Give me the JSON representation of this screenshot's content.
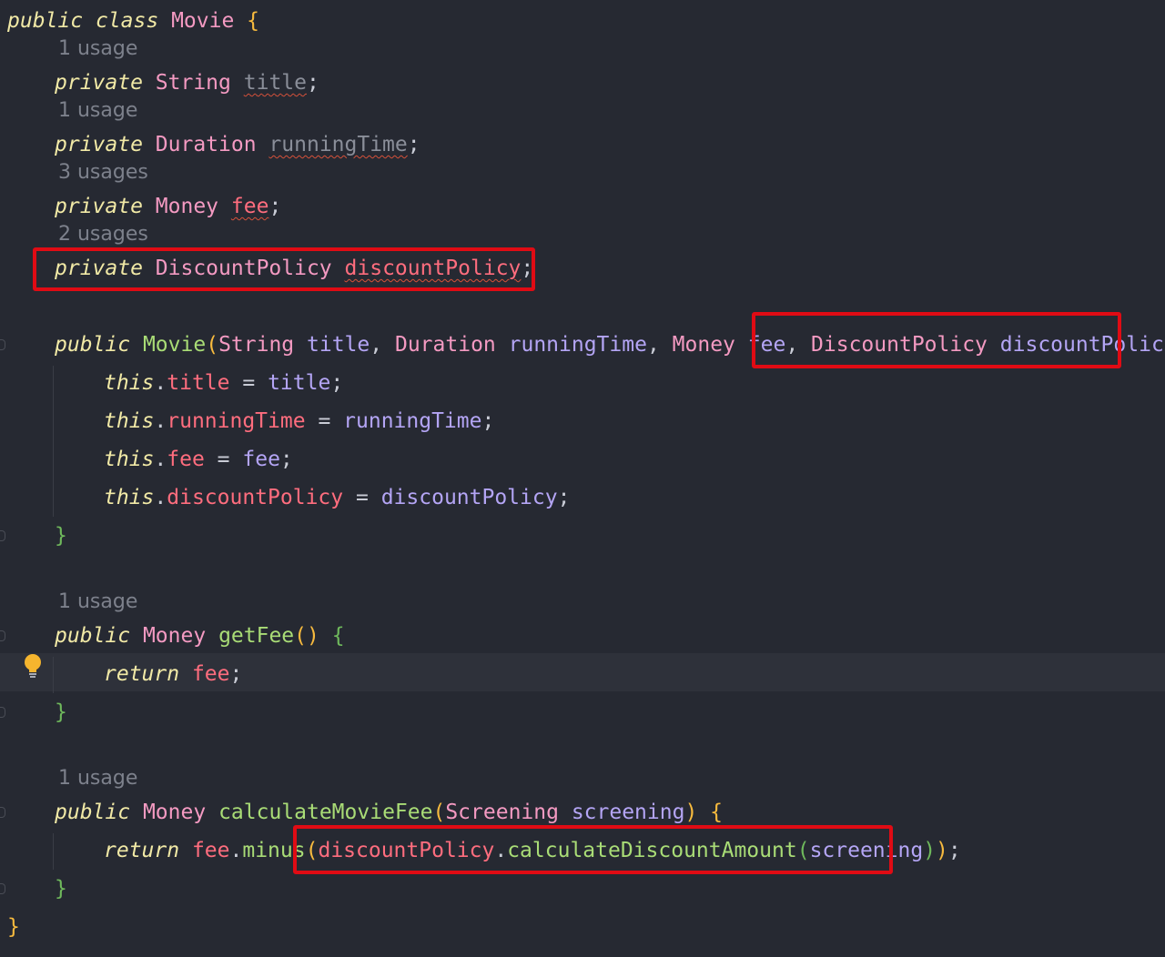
{
  "code": {
    "l_class": {
      "kw1": "public",
      "kw2": "class",
      "name": "Movie",
      "brace": "{"
    },
    "hint_title": "1 usage",
    "l_title": {
      "kw": "private",
      "type": "String",
      "name": "title",
      "semi": ";"
    },
    "hint_running": "1 usage",
    "l_running": {
      "kw": "private",
      "type": "Duration",
      "name": "runningTime",
      "semi": ";"
    },
    "hint_fee": "3 usages",
    "l_fee": {
      "kw": "private",
      "type": "Money",
      "name": "fee",
      "semi": ";"
    },
    "hint_policy": "2 usages",
    "l_policy": {
      "kw": "private",
      "type": "DiscountPolicy",
      "name": "discountPolicy",
      "semi": ";"
    },
    "l_ctor": {
      "kw": "public",
      "name": "Movie",
      "open": "(",
      "t1": "String",
      "p1": "title",
      "c1": ",",
      "t2": "Duration",
      "p2": "runningTime",
      "c2": ",",
      "t3": "Money",
      "p3": "fee",
      "c3": ",",
      "t4": "DiscountPolicy",
      "p4": "discountPolicy",
      "close": ")",
      "brace": "{"
    },
    "l_a1": {
      "this": "this",
      "dot": ".",
      "field": "title",
      "eq": "=",
      "val": "title",
      "semi": ";"
    },
    "l_a2": {
      "this": "this",
      "dot": ".",
      "field": "runningTime",
      "eq": "=",
      "val": "runningTime",
      "semi": ";"
    },
    "l_a3": {
      "this": "this",
      "dot": ".",
      "field": "fee",
      "eq": "=",
      "val": "fee",
      "semi": ";"
    },
    "l_a4": {
      "this": "this",
      "dot": ".",
      "field": "discountPolicy",
      "eq": "=",
      "val": "discountPolicy",
      "semi": ";"
    },
    "l_ctor_end": "}",
    "hint_getfee": "1 usage",
    "l_getfee": {
      "kw": "public",
      "type": "Money",
      "name": "getFee",
      "parens": "()",
      "brace": "{"
    },
    "l_ret1": {
      "kw": "return",
      "field": "fee",
      "semi": ";"
    },
    "l_getfee_end": "}",
    "hint_calc": "1 usage",
    "l_calc": {
      "kw": "public",
      "type": "Money",
      "name": "calculateMovieFee",
      "open": "(",
      "ptype": "Screening",
      "pname": "screening",
      "close": ")",
      "brace": "{"
    },
    "l_ret2": {
      "kw": "return",
      "field": "fee",
      "dot": ".",
      "m1": "minus",
      "open": "(",
      "field2": "discountPolicy",
      "dot2": ".",
      "m2": "calculateDiscountAmount",
      "open2": "(",
      "arg": "screening",
      "close2": ")",
      "close": ")",
      "semi": ";"
    },
    "l_calc_end": "}",
    "l_class_end": "}"
  },
  "icons": {
    "gutter": "fold-marker-icon",
    "bulb": "lightbulb-icon"
  },
  "colors": {
    "background": "#262932",
    "keyword": "#f1e9a6",
    "type": "#f49ac2",
    "method": "#a9dc76",
    "field": "#ff6d7e",
    "param": "#b4a5f5",
    "annotation_box": "#e00b14"
  }
}
